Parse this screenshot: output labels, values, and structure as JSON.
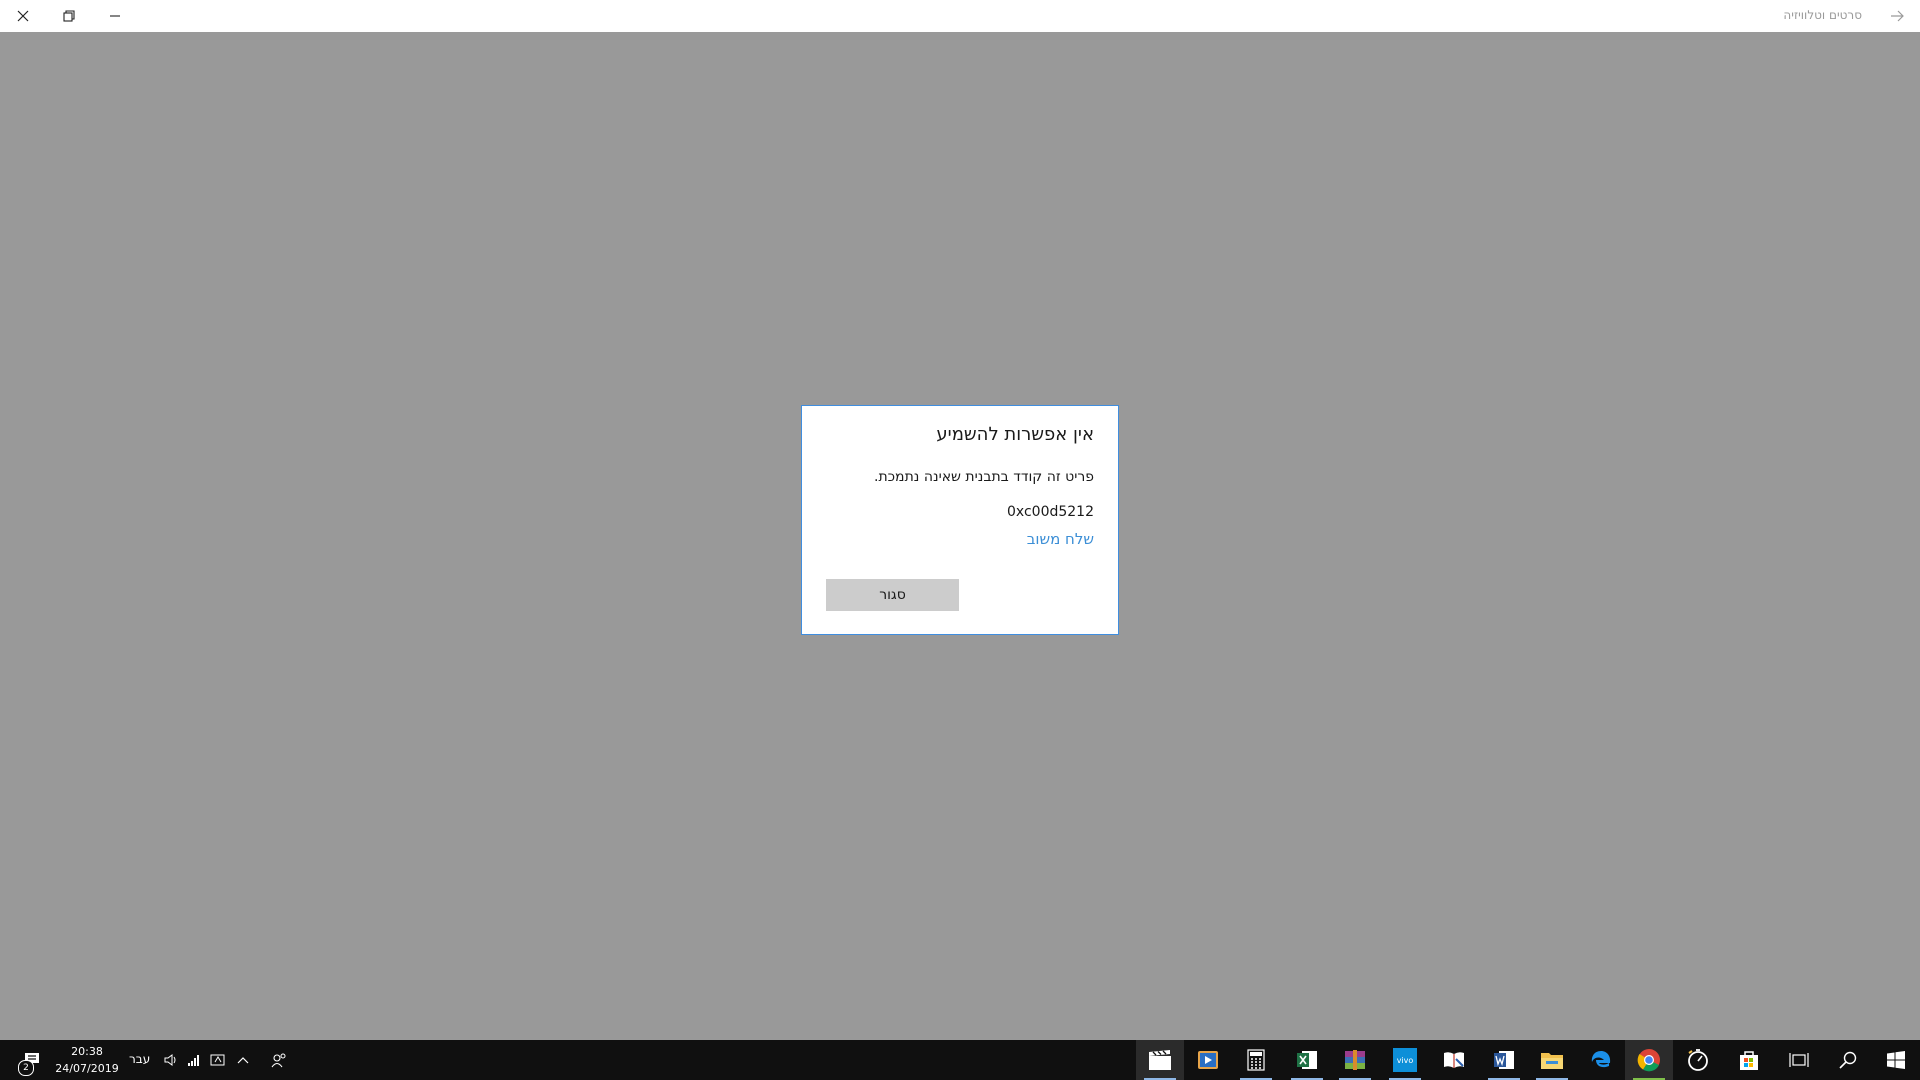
{
  "window": {
    "title": "סרטים וטלוויזיה"
  },
  "dialog": {
    "title": "אין אפשרות להשמיע",
    "message": "פריט זה קודד בתבנית שאינה נתמכת.",
    "error_code": "0xc00d5212",
    "feedback_link": "שלח משוב",
    "close_button": "סגור"
  },
  "taskbar": {
    "time": "20:38",
    "date": "24/07/2019",
    "language": "עבר",
    "notification_count": "2",
    "apps": [
      {
        "name": "movies-tv",
        "active": true
      },
      {
        "name": "media-player",
        "active": false
      },
      {
        "name": "calculator",
        "active": false
      },
      {
        "name": "excel",
        "active": false
      },
      {
        "name": "winrar",
        "active": false
      },
      {
        "name": "vivo",
        "active": false
      },
      {
        "name": "reader",
        "active": false
      },
      {
        "name": "word",
        "active": false
      },
      {
        "name": "file-explorer",
        "active": false
      },
      {
        "name": "edge",
        "active": false
      },
      {
        "name": "chrome",
        "active": false
      },
      {
        "name": "alarms",
        "active": false
      },
      {
        "name": "store",
        "active": false
      }
    ],
    "colors": {
      "background": "#101010",
      "accent": "#3f8ee0",
      "link": "#3b8ed6"
    }
  }
}
